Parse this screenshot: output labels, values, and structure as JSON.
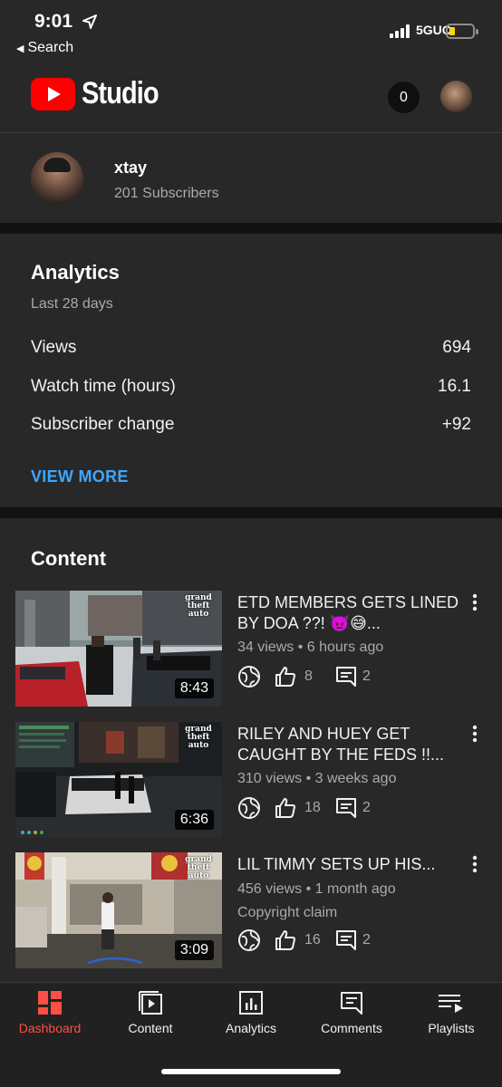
{
  "status_bar": {
    "time": "9:01",
    "back_label": "Search",
    "network": "5GUC"
  },
  "header": {
    "app_name": "Studio",
    "notification_count": "0",
    "avatar_icon": "profile-avatar"
  },
  "channel": {
    "name": "xtay",
    "subscribers": "201 Subscribers"
  },
  "analytics": {
    "title": "Analytics",
    "period": "Last 28 days",
    "metrics": [
      {
        "label": "Views",
        "value": "694"
      },
      {
        "label": "Watch time (hours)",
        "value": "16.1"
      },
      {
        "label": "Subscriber change",
        "value": "+92"
      }
    ],
    "view_more": "VIEW MORE"
  },
  "content": {
    "title": "Content",
    "videos": [
      {
        "title": "ETD MEMBERS GETS LINED BY DOA ??! 👿😅...",
        "meta": "34 views • 6 hours ago",
        "likes": "8",
        "comments": "2",
        "duration": "8:43",
        "thumb_logo": "grand theft auto"
      },
      {
        "title": "RILEY AND HUEY GET CAUGHT BY THE FEDS !!...",
        "meta": "310 views • 3 weeks ago",
        "likes": "18",
        "comments": "2",
        "duration": "6:36",
        "thumb_logo": "grand theft auto"
      },
      {
        "title": "LIL TIMMY SETS UP HIS...",
        "meta": "456 views • 1 month ago",
        "claim": "Copyright claim",
        "likes": "16",
        "comments": "2",
        "duration": "3:09",
        "thumb_logo": "grand theft auto"
      }
    ]
  },
  "nav": {
    "items": [
      {
        "label": "Dashboard",
        "icon": "dashboard-icon",
        "active": true
      },
      {
        "label": "Content",
        "icon": "content-icon",
        "active": false
      },
      {
        "label": "Analytics",
        "icon": "analytics-icon",
        "active": false
      },
      {
        "label": "Comments",
        "icon": "comments-icon",
        "active": false
      },
      {
        "label": "Playlists",
        "icon": "playlists-icon",
        "active": false
      }
    ]
  },
  "colors": {
    "background": "#282828",
    "accent_link": "#3ea6ff",
    "active_nav": "#ff4e45",
    "brand_red": "#ff0000",
    "separator": "#121212"
  }
}
